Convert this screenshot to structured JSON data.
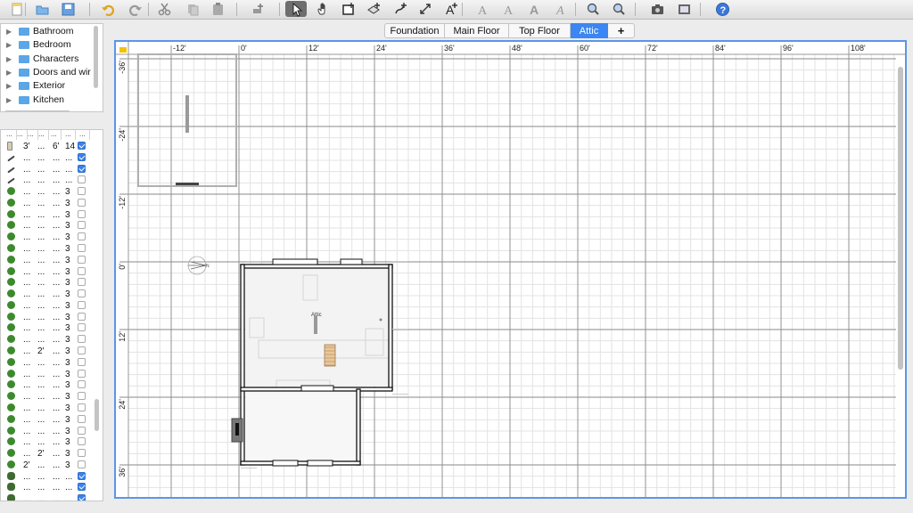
{
  "toolbar": {
    "buttons": [
      "new-home",
      "open",
      "save",
      "undo",
      "redo",
      "cut",
      "copy",
      "paste",
      "add-furniture",
      "select",
      "pan",
      "create-walls",
      "create-rooms",
      "create-polylines",
      "create-dimensions",
      "add-text",
      "text-style-1",
      "text-style-2",
      "text-style-3",
      "text-style-4",
      "zoom-in",
      "zoom-out",
      "create-photo",
      "create-video",
      "help"
    ]
  },
  "catalog": {
    "categories": [
      "Bathroom",
      "Bedroom",
      "Characters",
      "Doors and wir",
      "Exterior",
      "Kitchen"
    ]
  },
  "furniture": {
    "headers": [
      "...",
      "...",
      "...",
      "...",
      "...",
      "...",
      "..."
    ],
    "rows": [
      {
        "icon": "door-icon",
        "c1": "3'",
        "c2": "...",
        "c3": "6'",
        "c4": "14",
        "checked": true
      },
      {
        "icon": "tool-icon",
        "c1": "...",
        "c2": "...",
        "c3": "...",
        "c4": "...",
        "checked": true
      },
      {
        "icon": "tool-icon",
        "c1": "...",
        "c2": "...",
        "c3": "...",
        "c4": "...",
        "checked": true
      },
      {
        "icon": "tool-icon",
        "c1": "...",
        "c2": "...",
        "c3": "...",
        "c4": "...",
        "checked": false
      },
      {
        "icon": "info-icon",
        "c1": "...",
        "c2": "...",
        "c3": "...",
        "c4": "3",
        "checked": false
      },
      {
        "icon": "info-icon",
        "c1": "...",
        "c2": "...",
        "c3": "...",
        "c4": "3",
        "checked": false
      },
      {
        "icon": "info-icon",
        "c1": "...",
        "c2": "...",
        "c3": "...",
        "c4": "3",
        "checked": false
      },
      {
        "icon": "info-icon",
        "c1": "...",
        "c2": "...",
        "c3": "...",
        "c4": "3",
        "checked": false
      },
      {
        "icon": "info-icon",
        "c1": "...",
        "c2": "...",
        "c3": "...",
        "c4": "3",
        "checked": false
      },
      {
        "icon": "info-icon",
        "c1": "...",
        "c2": "...",
        "c3": "...",
        "c4": "3",
        "checked": false
      },
      {
        "icon": "info-icon",
        "c1": "...",
        "c2": "...",
        "c3": "...",
        "c4": "3",
        "checked": false
      },
      {
        "icon": "info-icon",
        "c1": "...",
        "c2": "...",
        "c3": "...",
        "c4": "3",
        "checked": false
      },
      {
        "icon": "info-icon",
        "c1": "...",
        "c2": "...",
        "c3": "...",
        "c4": "3",
        "checked": false
      },
      {
        "icon": "info-icon",
        "c1": "...",
        "c2": "...",
        "c3": "...",
        "c4": "3",
        "checked": false
      },
      {
        "icon": "info-icon",
        "c1": "...",
        "c2": "...",
        "c3": "...",
        "c4": "3",
        "checked": false
      },
      {
        "icon": "info-icon",
        "c1": "...",
        "c2": "...",
        "c3": "...",
        "c4": "3",
        "checked": false
      },
      {
        "icon": "info-icon",
        "c1": "...",
        "c2": "...",
        "c3": "...",
        "c4": "3",
        "checked": false
      },
      {
        "icon": "info-icon",
        "c1": "...",
        "c2": "...",
        "c3": "...",
        "c4": "3",
        "checked": false
      },
      {
        "icon": "info-icon",
        "c1": "...",
        "c2": "2'",
        "c3": "...",
        "c4": "3",
        "checked": false
      },
      {
        "icon": "info-icon",
        "c1": "...",
        "c2": "...",
        "c3": "...",
        "c4": "3",
        "checked": false
      },
      {
        "icon": "info-icon",
        "c1": "...",
        "c2": "...",
        "c3": "...",
        "c4": "3",
        "checked": false
      },
      {
        "icon": "info-icon",
        "c1": "...",
        "c2": "...",
        "c3": "...",
        "c4": "3",
        "checked": false
      },
      {
        "icon": "info-icon",
        "c1": "...",
        "c2": "...",
        "c3": "...",
        "c4": "3",
        "checked": false
      },
      {
        "icon": "info-icon",
        "c1": "...",
        "c2": "...",
        "c3": "...",
        "c4": "3",
        "checked": false
      },
      {
        "icon": "info-icon",
        "c1": "...",
        "c2": "...",
        "c3": "...",
        "c4": "3",
        "checked": false
      },
      {
        "icon": "info-icon",
        "c1": "...",
        "c2": "...",
        "c3": "...",
        "c4": "3",
        "checked": false
      },
      {
        "icon": "info-icon",
        "c1": "...",
        "c2": "...",
        "c3": "...",
        "c4": "3",
        "checked": false
      },
      {
        "icon": "info-icon",
        "c1": "...",
        "c2": "2'",
        "c3": "...",
        "c4": "3",
        "checked": false
      },
      {
        "icon": "info-icon",
        "c1": "2'",
        "c2": "...",
        "c3": "...",
        "c4": "3",
        "checked": false
      },
      {
        "icon": "plant-icon",
        "c1": "...",
        "c2": "...",
        "c3": "...",
        "c4": "...",
        "checked": true
      },
      {
        "icon": "plant-icon",
        "c1": "...",
        "c2": "...",
        "c3": "...",
        "c4": "...",
        "checked": true
      },
      {
        "icon": "plant-icon",
        "c1": "...",
        "c2": "...",
        "c3": "...",
        "c4": "...",
        "checked": true
      }
    ]
  },
  "tabs": [
    {
      "label": "Foundation",
      "selected": false
    },
    {
      "label": "Main Floor",
      "selected": false
    },
    {
      "label": "Top Floor",
      "selected": false
    },
    {
      "label": "Attic",
      "selected": true
    },
    {
      "label": "+",
      "selected": false
    }
  ],
  "plan": {
    "ruler_x": [
      "-12'",
      "0'",
      "12'",
      "24'",
      "36'",
      "48'",
      "60'",
      "72'",
      "84'",
      "96'",
      "108'"
    ],
    "ruler_y": [
      "-36'",
      "-24'",
      "-12'",
      "0'",
      "12'",
      "24'",
      "36'"
    ],
    "room_label": "Attic",
    "compass_label": "N"
  },
  "colors": {
    "accent": "#3b86f2",
    "wall": "#1a1a1a",
    "grid": "#d9d9d9"
  }
}
